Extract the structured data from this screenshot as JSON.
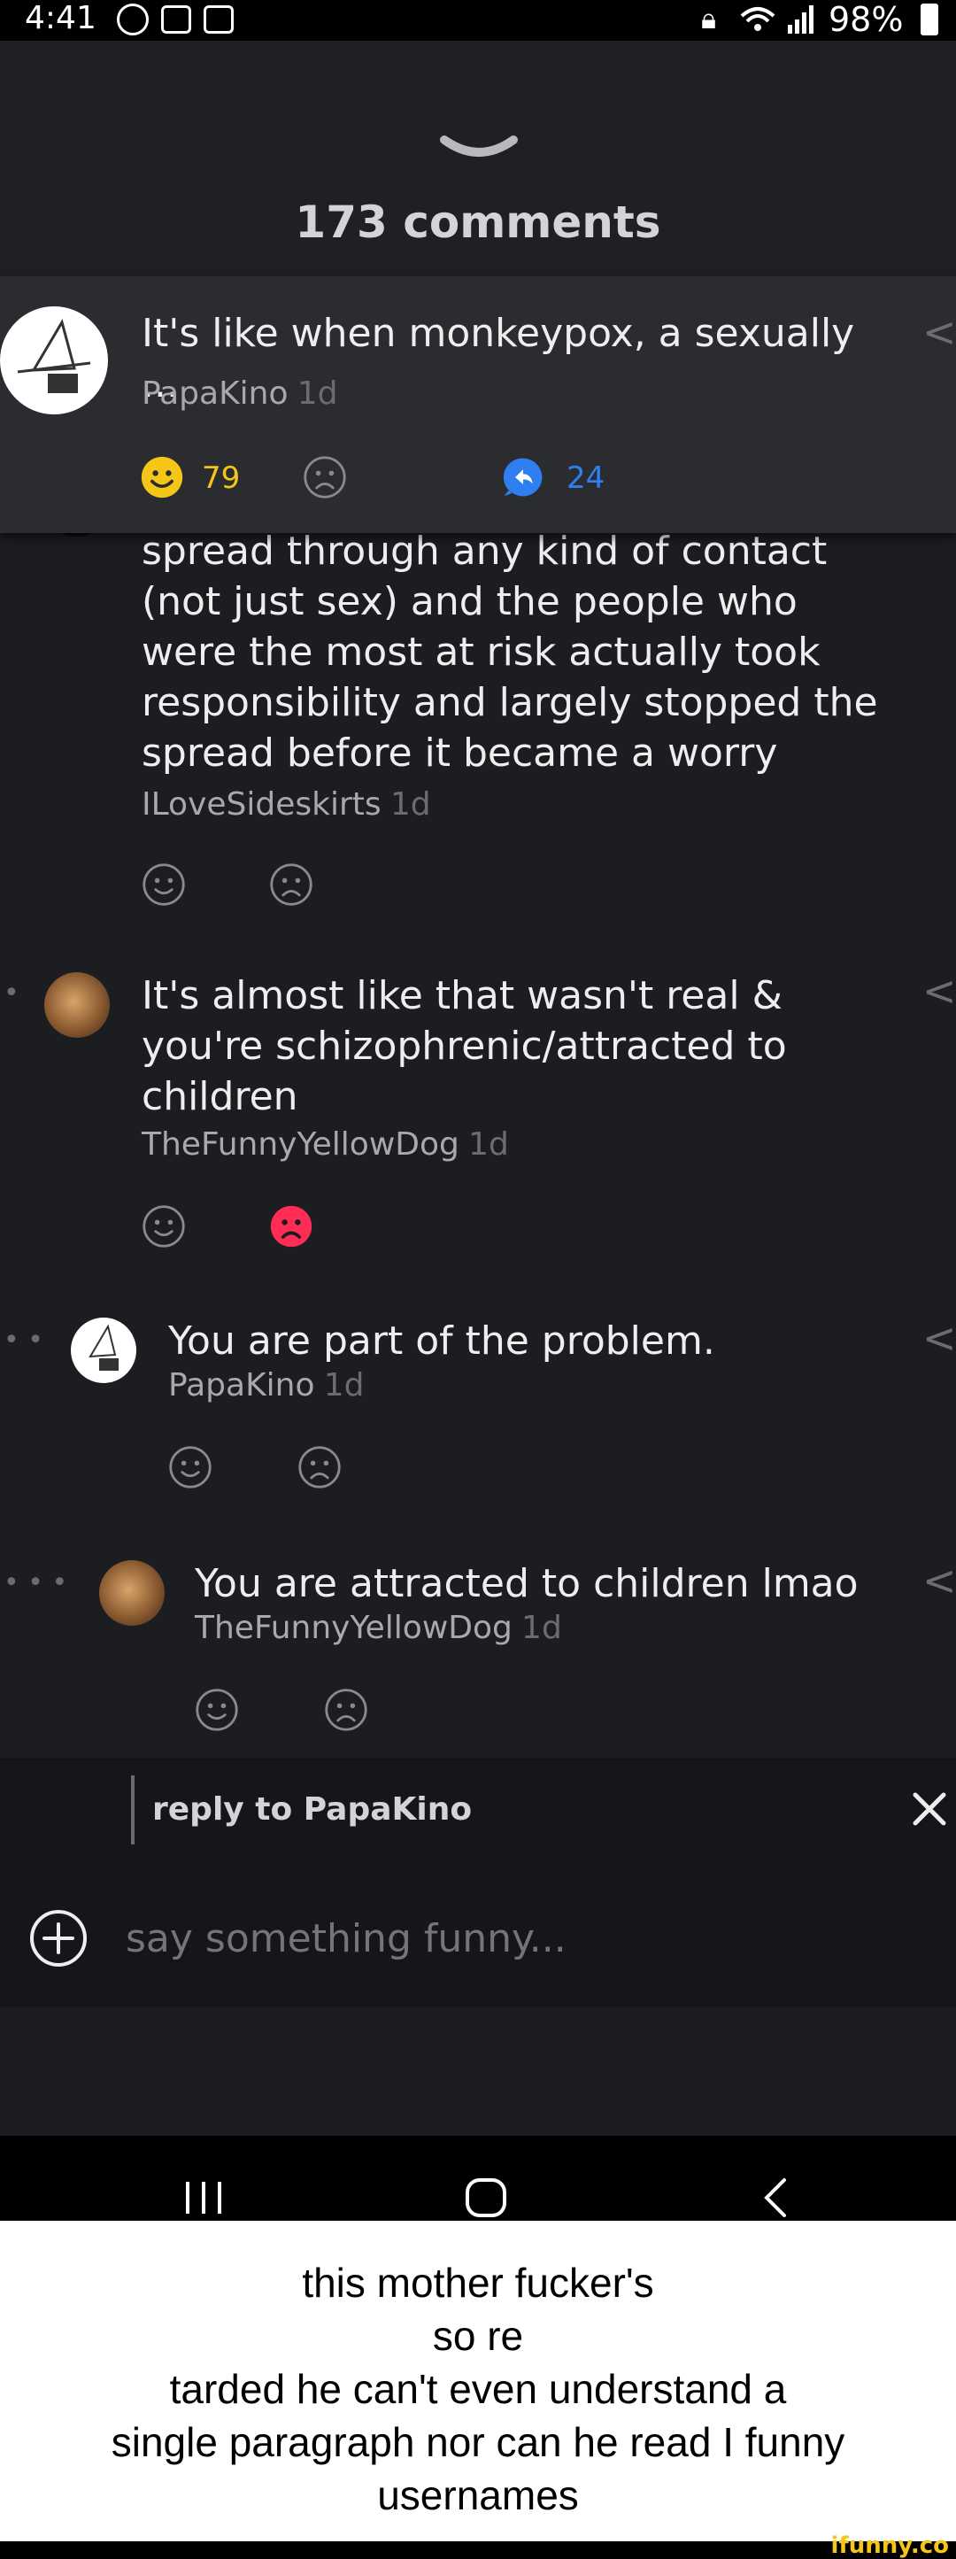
{
  "status_bar": {
    "time": "4:41",
    "battery": "98%"
  },
  "header": {
    "comments_count": "173 comments"
  },
  "pinned_comment": {
    "text": "It's like when monkeypox, a sexually ...",
    "user": "PapaKino",
    "age": "1d",
    "likes": "79",
    "replies": "24"
  },
  "comments": [
    {
      "lines": [
        "spread through any kind of contact",
        "(not just sex) and the people who",
        "were the most at risk actually took",
        "responsibility and largely stopped the",
        "spread before it became a worry"
      ],
      "user": "ILoveSideskirts",
      "age": "1d"
    },
    {
      "lines": [
        "It's almost like that wasn't real &",
        "you're schizophrenic/attracted to",
        "children"
      ],
      "user": "TheFunnyYellowDog",
      "age": "1d"
    },
    {
      "lines": [
        "You are part of the problem."
      ],
      "user": "PapaKino",
      "age": "1d"
    },
    {
      "lines": [
        "You are attracted to children lmao"
      ],
      "user": "TheFunnyYellowDog",
      "age": "1d"
    }
  ],
  "reply_bar": {
    "reply_to": "reply to PapaKino",
    "placeholder": "say something funny..."
  },
  "caption": {
    "lines": [
      "this mother fucker's",
      "so re",
      "tarded he can't even understand a",
      "single paragraph nor can he read I funny",
      "usernames"
    ]
  },
  "watermark": "ifunny.co",
  "colors": {
    "accent_yellow": "#f5c518",
    "accent_blue": "#2f7ff0",
    "downvote_active": "#ff2d55"
  }
}
